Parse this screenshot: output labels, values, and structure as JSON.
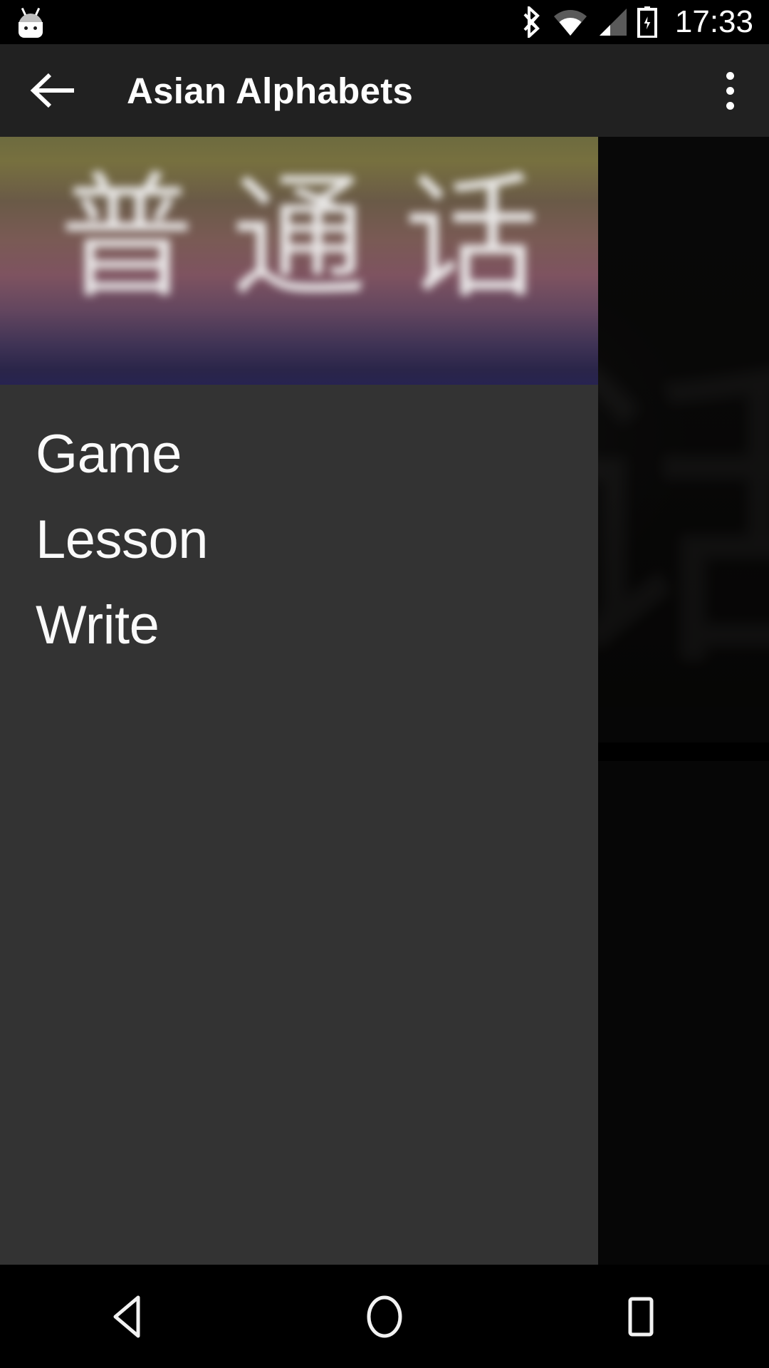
{
  "status_bar": {
    "notification_icon": "android-bugdroid-icon",
    "icons": [
      "bluetooth-icon",
      "wifi-icon",
      "cellular-signal-icon",
      "battery-charging-icon"
    ],
    "clock": "17:33"
  },
  "app_bar": {
    "back_icon": "back-arrow-icon",
    "title": "Asian Alphabets",
    "overflow_icon": "overflow-menu-icon"
  },
  "nav_drawer": {
    "header": {
      "glyphs": "普通话",
      "gradient_top": "#6d6b3f",
      "gradient_mid": "#7e5360",
      "gradient_bottom": "#272350"
    },
    "background_color": "#333333",
    "items": [
      {
        "label": "Game",
        "name": "drawer-item-game"
      },
      {
        "label": "Lesson",
        "name": "drawer-item-lesson"
      },
      {
        "label": "Write",
        "name": "drawer-item-write"
      }
    ]
  },
  "background_content": {
    "glyph": "话"
  },
  "nav_bar": {
    "back_label": "back-nav-icon",
    "home_label": "home-nav-icon",
    "recents_label": "recents-nav-icon"
  }
}
